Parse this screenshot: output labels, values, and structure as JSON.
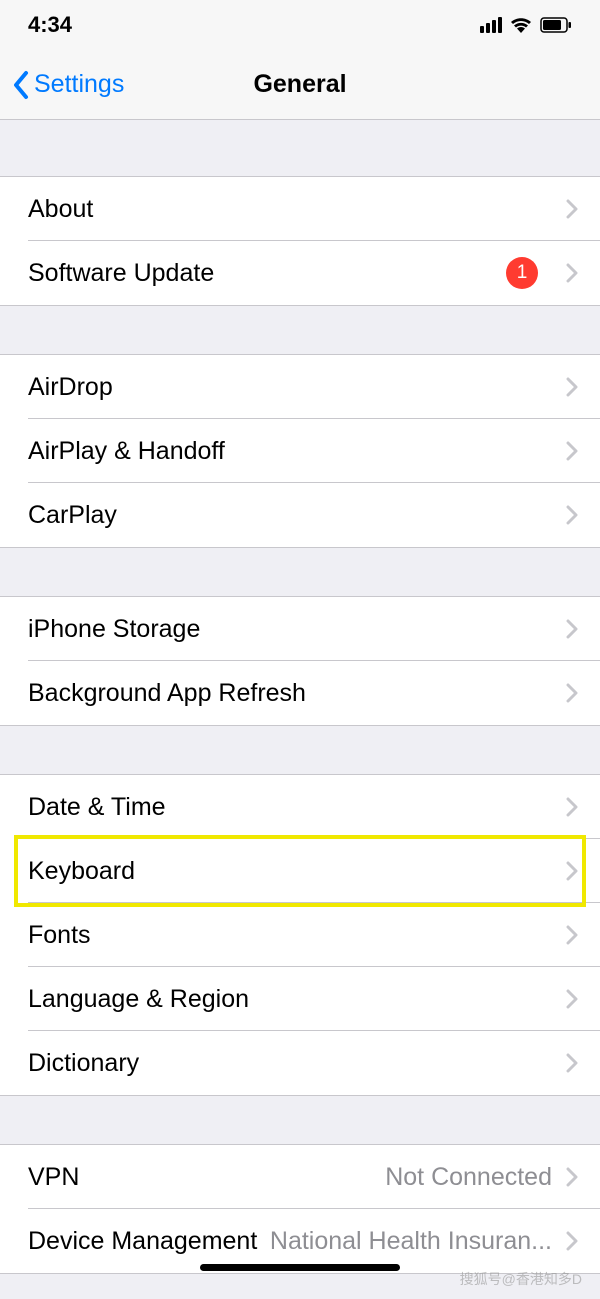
{
  "status": {
    "time": "4:34"
  },
  "nav": {
    "back_label": "Settings",
    "title": "General"
  },
  "groups": [
    {
      "rows": [
        {
          "label": "About"
        },
        {
          "label": "Software Update",
          "badge": "1"
        }
      ]
    },
    {
      "rows": [
        {
          "label": "AirDrop"
        },
        {
          "label": "AirPlay & Handoff"
        },
        {
          "label": "CarPlay"
        }
      ]
    },
    {
      "rows": [
        {
          "label": "iPhone Storage"
        },
        {
          "label": "Background App Refresh"
        }
      ]
    },
    {
      "rows": [
        {
          "label": "Date & Time"
        },
        {
          "label": "Keyboard",
          "highlighted": true
        },
        {
          "label": "Fonts"
        },
        {
          "label": "Language & Region"
        },
        {
          "label": "Dictionary"
        }
      ]
    },
    {
      "rows": [
        {
          "label": "VPN",
          "value": "Not Connected"
        },
        {
          "label": "Device Management",
          "value": "National Health Insuran..."
        }
      ]
    }
  ],
  "watermark": "搜狐号@香港知多D"
}
